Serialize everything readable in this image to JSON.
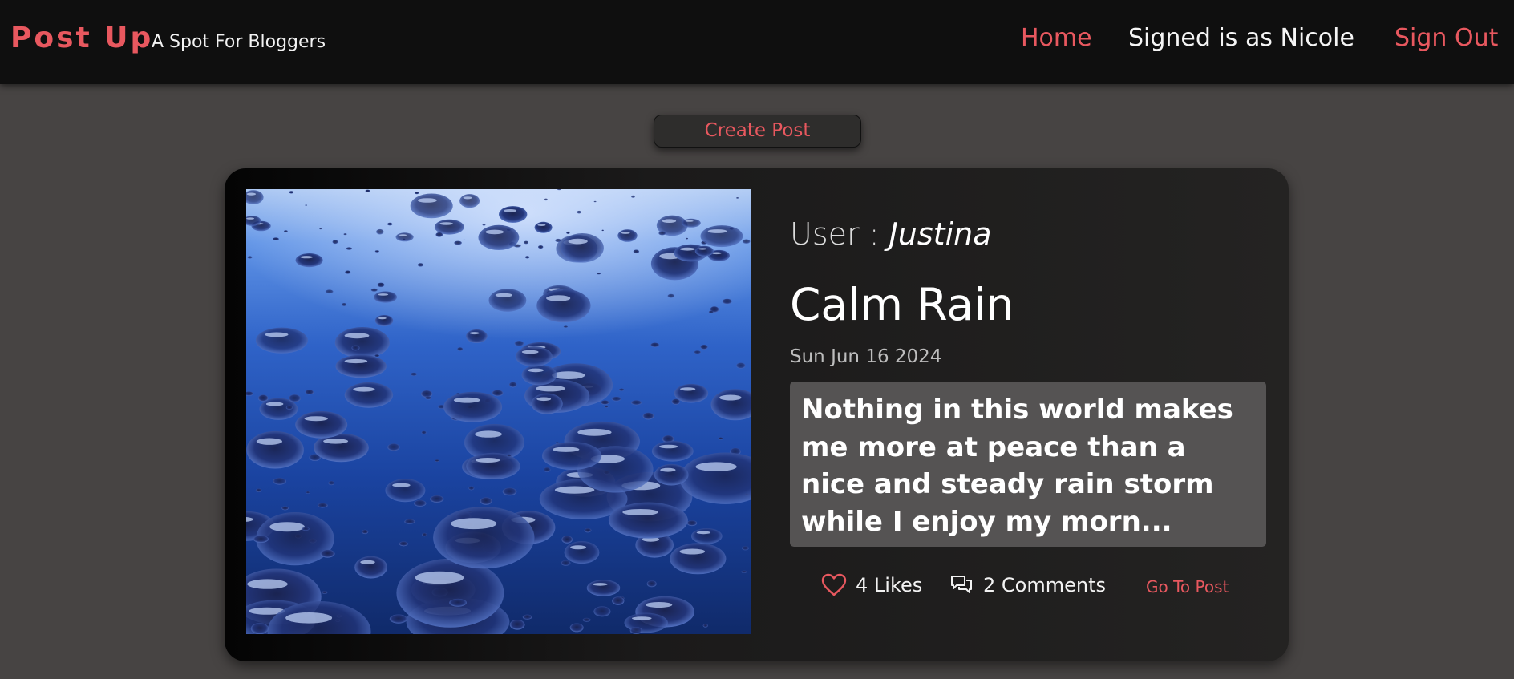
{
  "header": {
    "brand": "Post Up",
    "tagline": "A Spot For Bloggers",
    "nav": {
      "home": "Home",
      "signed_in": "Signed is as Nicole",
      "sign_out": "Sign Out"
    }
  },
  "actions": {
    "create_post": "Create Post"
  },
  "post": {
    "user_prefix": "User : ",
    "user": "Justina",
    "title": "Calm Rain",
    "date": "Sun Jun 16 2024",
    "excerpt": "Nothing in this world makes me more at peace than a nice and steady rain storm while I enjoy my morn...",
    "likes": "4 Likes",
    "comments": "2 Comments",
    "go_to_post": "Go To Post",
    "icons": {
      "image": "rain-drops-photo",
      "likes": "heart-icon",
      "comments": "comments-icon"
    }
  },
  "colors": {
    "accent": "#e8585f",
    "header_bg": "#0f0f0f",
    "page_bg": "#474443",
    "card_bg": "#242322",
    "excerpt_bg": "#555353"
  }
}
